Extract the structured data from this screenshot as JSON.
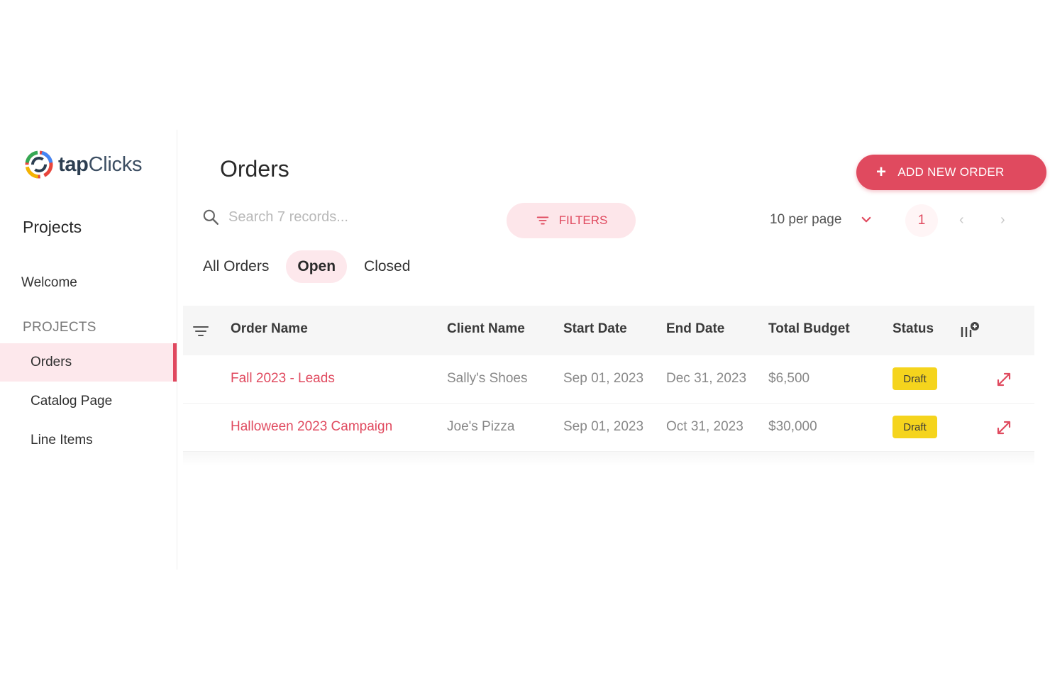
{
  "brand": {
    "name_part1": "tap",
    "name_part2": "Clicks"
  },
  "sidebar": {
    "title": "Projects",
    "welcome": "Welcome",
    "section_label": "PROJECTS",
    "items": [
      {
        "label": "Orders",
        "active": true
      },
      {
        "label": "Catalog Page",
        "active": false
      },
      {
        "label": "Line Items",
        "active": false
      }
    ]
  },
  "header": {
    "title": "Orders",
    "add_button": "ADD NEW ORDER"
  },
  "toolbar": {
    "search_placeholder": "Search 7 records...",
    "filters_label": "FILTERS",
    "per_page": "10 per page",
    "page_number": "1",
    "prev_icon": "‹",
    "next_icon": "›"
  },
  "tabs": [
    {
      "label": "All Orders",
      "active": false
    },
    {
      "label": "Open",
      "active": true
    },
    {
      "label": "Closed",
      "active": false
    }
  ],
  "table": {
    "columns": [
      "Order Name",
      "Client Name",
      "Start Date",
      "End Date",
      "Total Budget",
      "Status"
    ],
    "rows": [
      {
        "order_name": "Fall 2023 - Leads",
        "client_name": "Sally's Shoes",
        "start_date": "Sep 01, 2023",
        "end_date": "Dec 31, 2023",
        "total_budget": "$6,500",
        "status": "Draft"
      },
      {
        "order_name": "Halloween 2023 Campaign",
        "client_name": "Joe's Pizza",
        "start_date": "Sep 01, 2023",
        "end_date": "Oct 31, 2023",
        "total_budget": "$30,000",
        "status": "Draft"
      }
    ]
  },
  "colors": {
    "accent": "#e04a5f",
    "accent_light": "#fde8ec",
    "badge": "#f5d41d"
  }
}
